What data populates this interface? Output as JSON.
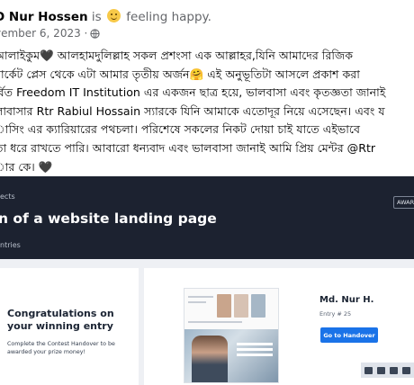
{
  "post": {
    "author": "D Nur Hossen",
    "is": "is",
    "feeling": "feeling happy.",
    "date": "vember 6, 2023 ·",
    "lines": [
      "আলাইকুম🖤 আলহামদুলিল্লাহ সকল প্রশংসা এক আল্লাহর,যিনি আমাদের রিজিক",
      "মার্কেট প্লেস থেকে এটা আমার তৃতীয় অর্জন🤗 এই অনুভূতিটা আসলে প্রকাশ করা",
      "র্বিত Freedom IT Institution এর একজন ছাত্র হয়ে, ভালবাসা এবং কৃতজ্ঞতা জানাই",
      "লাবাসার Rtr Rabiul Hossain স্যারকে যিনি আমাকে এতোদূর নিয়ে এসেছেন। এবং য",
      "াসিং এর ক্যারিয়ারের পথচলা। পরিশেষে সকলের নিকট দোয়া চাই যাতে এইভাবে",
      "তা ধরে রাখতে পারি। আবারো ধন্যবাদ এবং ভালবাসা জানাই আমি প্রিয় মেন্টর @Rtr",
      "ার কে। 🖤"
    ]
  },
  "screenshot": {
    "breadcrumb": "ects",
    "title": "n of a website landing page",
    "subtitle": "ntries",
    "award_label": "AWAR",
    "congrats_heading": "Congratulations on your winning entry",
    "congrats_desc": "Complete the Contest Handover to be awarded your prize money!",
    "winner_name": "Md. Nur H.",
    "entry": "Entry # 25",
    "handover_button": "Go to Handover"
  },
  "colors": {
    "dark_header": "#1c2230",
    "accent_blue": "#1a73e8"
  }
}
